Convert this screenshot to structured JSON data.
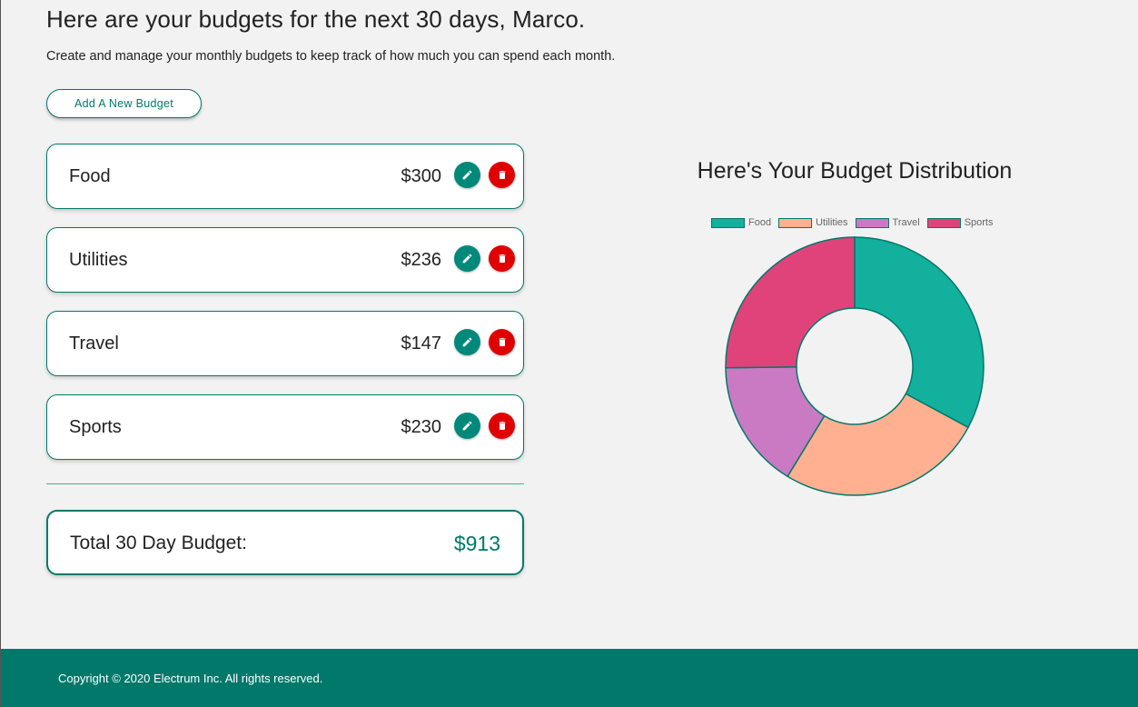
{
  "header": {
    "title": "Here are your budgets for the next 30 days, Marco.",
    "subtitle": "Create and manage your monthly budgets to keep track of how much you can spend each month.",
    "add_button_label": "Add A New Budget"
  },
  "budgets": [
    {
      "name": "Food",
      "amount": "$300"
    },
    {
      "name": "Utilities",
      "amount": "$236"
    },
    {
      "name": "Travel",
      "amount": "$147"
    },
    {
      "name": "Sports",
      "amount": "$230"
    }
  ],
  "actions": {
    "edit_icon": "pencil-icon",
    "delete_icon": "trash-icon"
  },
  "total": {
    "label": "Total 30 Day Budget:",
    "value": "$913"
  },
  "chart_title": "Here's Your Budget Distribution",
  "chart_data": {
    "type": "pie",
    "categories": [
      "Food",
      "Utilities",
      "Travel",
      "Sports"
    ],
    "values": [
      300,
      236,
      147,
      230
    ],
    "colors": [
      "#13b09d",
      "#ffb091",
      "#c97ac2",
      "#e0437a"
    ],
    "legend_placement": "top"
  },
  "colors": {
    "accent": "#00796b",
    "delete": "#e00000",
    "edit": "#00897b"
  },
  "footer": {
    "text": "Copyright © 2020 Electrum Inc. All rights reserved."
  }
}
